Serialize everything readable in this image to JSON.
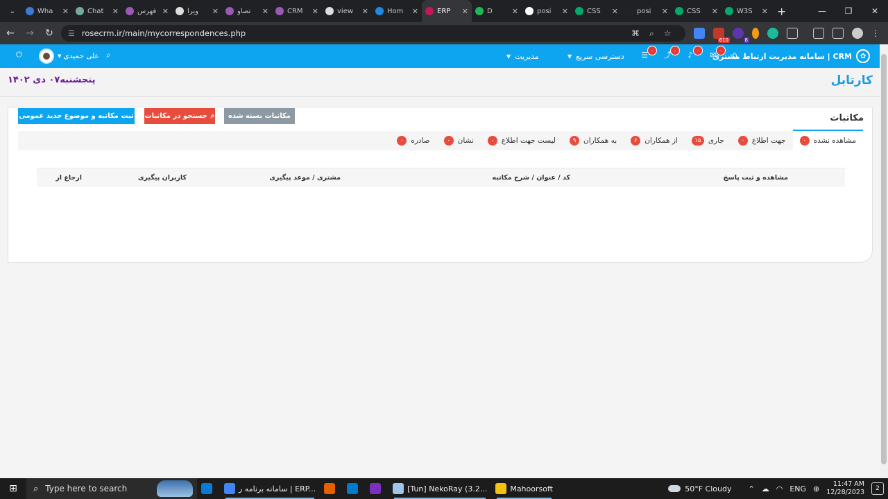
{
  "browser": {
    "tabs": [
      {
        "title": "Wha",
        "color": "#3a7bd5"
      },
      {
        "title": "Chat",
        "color": "#74aa9c"
      },
      {
        "title": "فهرس",
        "color": "#9b59b6"
      },
      {
        "title": "ویرا",
        "color": "#dddddd"
      },
      {
        "title": "تصاو",
        "color": "#9b59b6"
      },
      {
        "title": "CRM",
        "color": "#9b59b6"
      },
      {
        "title": "view",
        "color": "#dddddd"
      },
      {
        "title": "Hom",
        "color": "#1e88e5"
      },
      {
        "title": "ERP",
        "color": "#c2185b",
        "active": true
      },
      {
        "title": "D",
        "color": "#1db954"
      },
      {
        "title": "posi",
        "color": "#ffffff"
      },
      {
        "title": "CSS",
        "color": "#04aa6d"
      },
      {
        "title": "posi",
        "color": "#222222"
      },
      {
        "title": "CSS",
        "color": "#04aa6d"
      },
      {
        "title": "W3S",
        "color": "#04aa6d"
      }
    ],
    "url": "rosecrm.ir/main/mycorrespondences.php",
    "ext_badge_1": "610",
    "ext_badge_2": "8"
  },
  "nav": {
    "brand": "CRM | سامانه مدیریت ارتباط مشتری",
    "badges": [
      "۰",
      "۰",
      "۰",
      "۰"
    ],
    "quick_access": "دسترسی سریع",
    "management": "مدیریت",
    "user_name": "علی حمیدی"
  },
  "page": {
    "title": "کارتابل",
    "date": "پنجشنبه۰۷ دی ۱۴۰۲"
  },
  "card": {
    "title": "مکاتبات",
    "btn_closed": "مکاتبات بسته شده",
    "btn_search": "جستجو در مکاتبات",
    "btn_new": "ثبت مکاتبه و موضوع جدید عمومی",
    "tabs": [
      {
        "label": "مشاهده نشده",
        "count": "۰"
      },
      {
        "label": "جهت اطلاع",
        "count": "۰"
      },
      {
        "label": "جاری",
        "count": "۱۵"
      },
      {
        "label": "از همکاران",
        "count": "۶"
      },
      {
        "label": "به همکاران",
        "count": "۹"
      },
      {
        "label": "لیست جهت اطلاع",
        "count": "۰"
      },
      {
        "label": "نشان",
        "count": "۰"
      },
      {
        "label": "صادره",
        "count": "۰"
      }
    ],
    "columns": [
      "مشاهده و ثبت پاسخ",
      "کد / عنوان / شرح مکاتبه",
      "مشتری / موعد پیگیری",
      "کاربران پیگیری",
      "ارجاع از"
    ]
  },
  "taskbar": {
    "search_placeholder": "Type here to search",
    "apps": [
      {
        "label": "",
        "color": "#0a7bd4"
      },
      {
        "label": "سامانه برنامه ر | ERP...",
        "color": "#4285f4",
        "running": true
      },
      {
        "label": "",
        "color": "#e66000"
      },
      {
        "label": "",
        "color": "#007acc"
      },
      {
        "label": "",
        "color": "#7b2fbf"
      },
      {
        "label": "[Tun] NekoRay (3.2...",
        "color": "#9fc6e8",
        "running": true
      },
      {
        "label": "Mahoorsoft",
        "color": "#f1c40f",
        "running": true
      }
    ],
    "weather": "50°F  Cloudy",
    "lang": "ENG",
    "time": "11:47 AM",
    "date": "12/28/2023",
    "notif_count": "2"
  }
}
